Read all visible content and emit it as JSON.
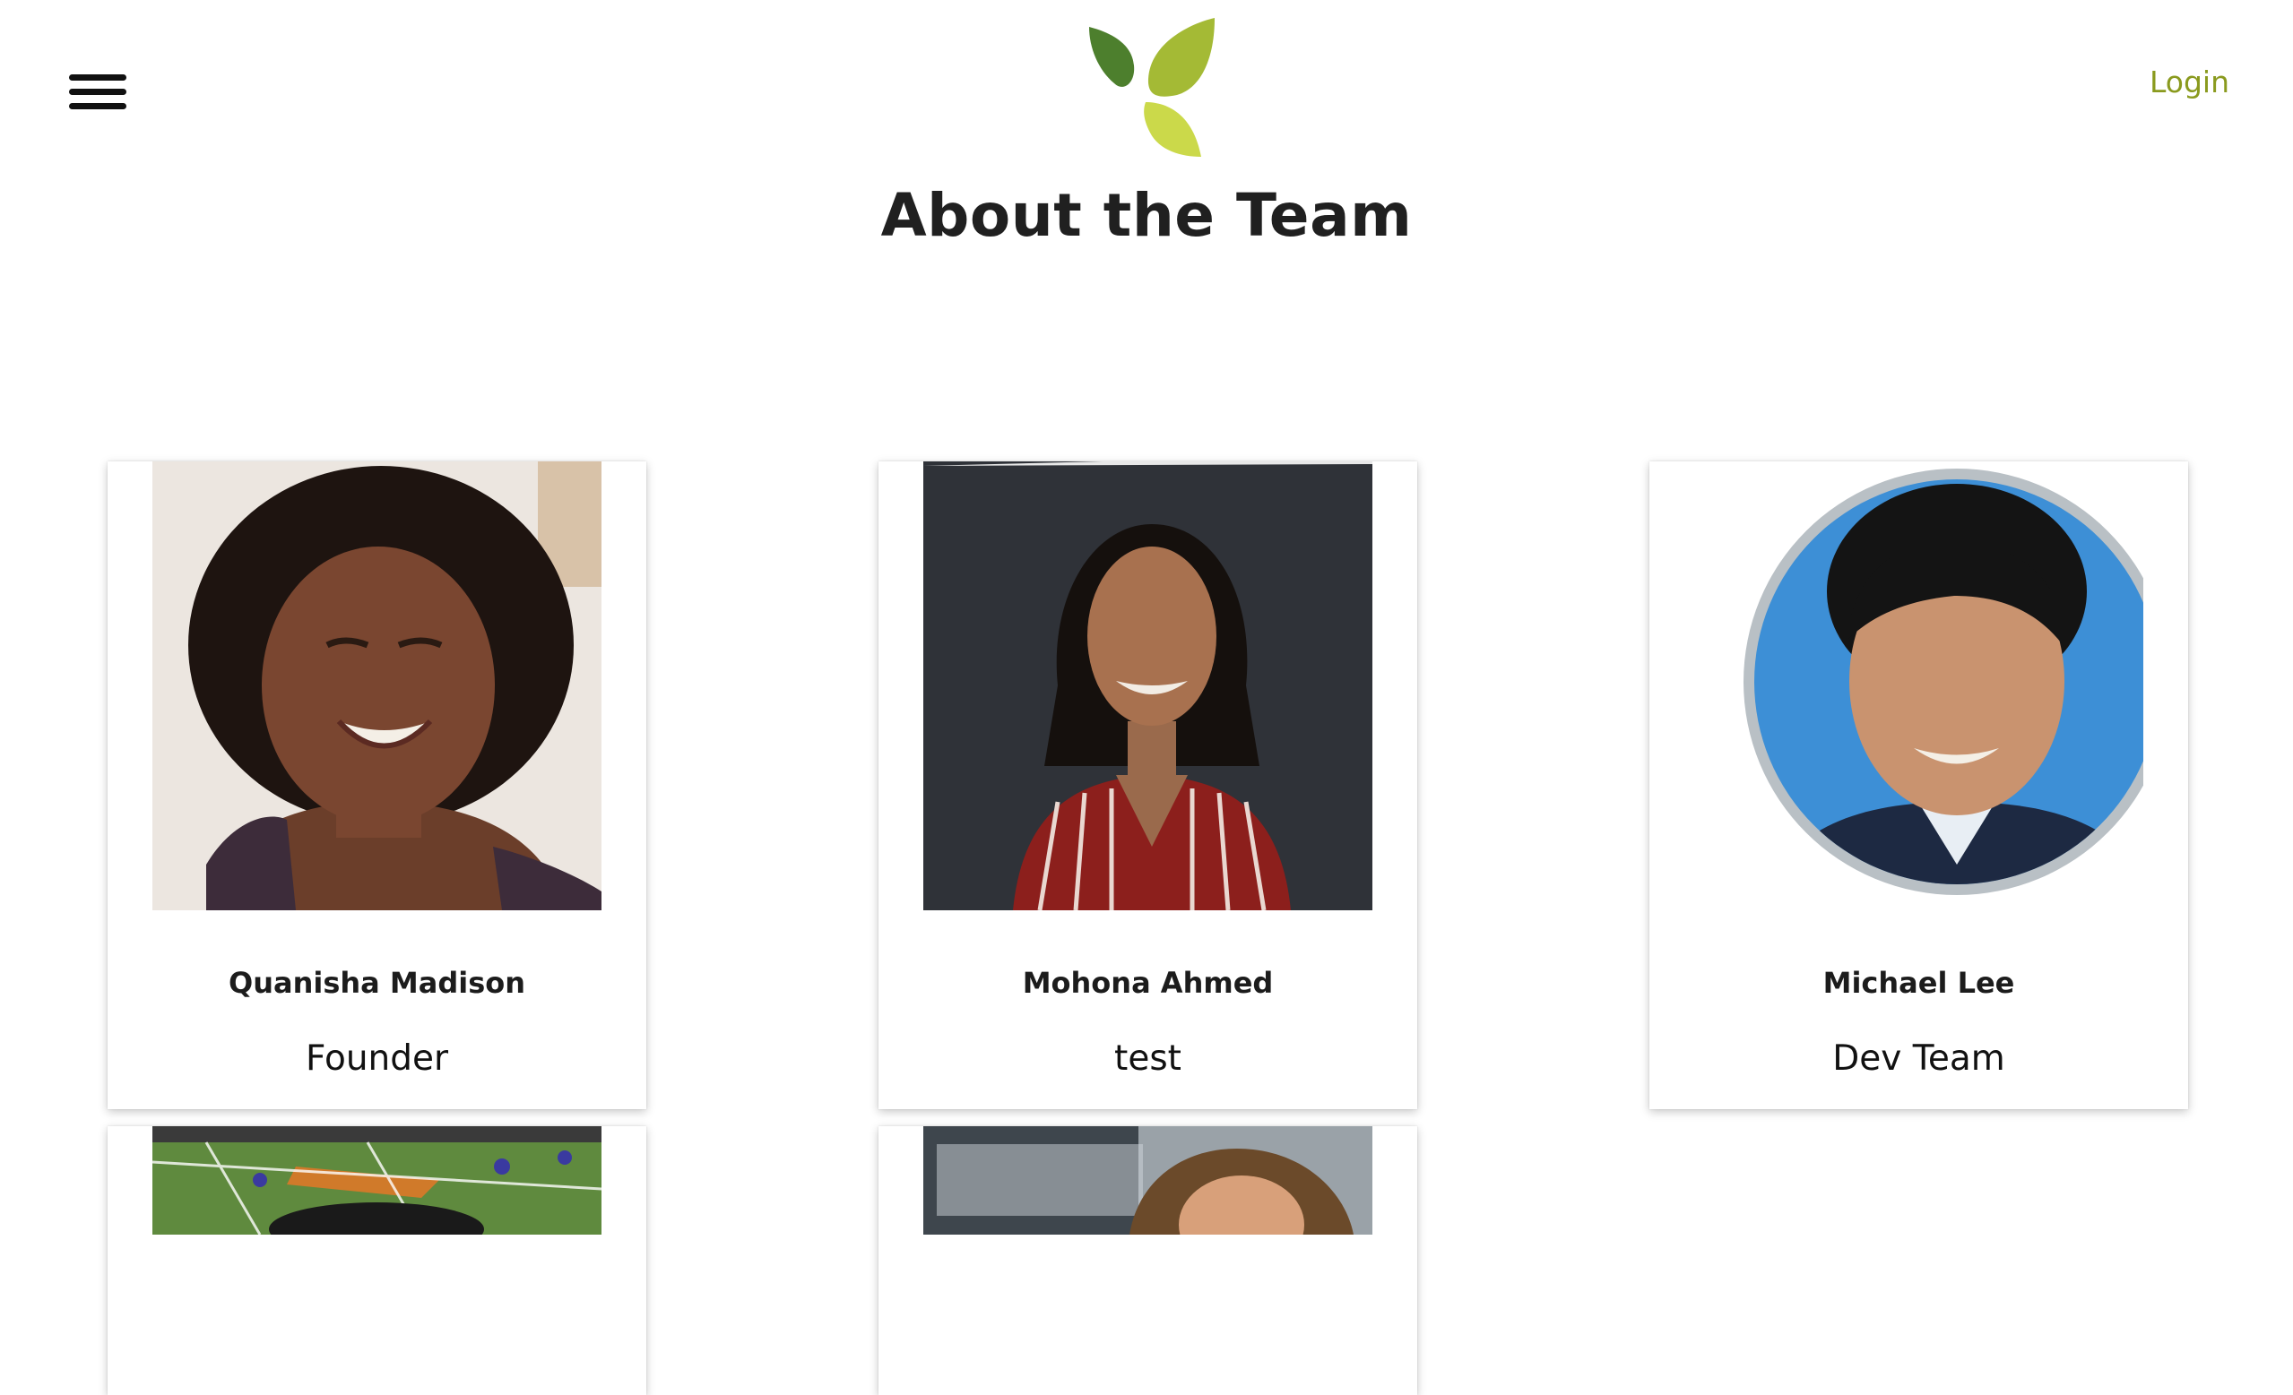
{
  "header": {
    "title": "About the Team",
    "login_label": "Login"
  },
  "colors": {
    "accent": "#8a9a1e",
    "logo_dark_leaf": "#4d7f2d",
    "logo_mid_leaf": "#a4ba35",
    "logo_light_leaf": "#cbd94a"
  },
  "team": [
    {
      "name": "Quanisha Madison",
      "role": "Founder"
    },
    {
      "name": "Mohona Ahmed",
      "role": "test"
    },
    {
      "name": "Michael Lee",
      "role": "Dev Team"
    }
  ],
  "icons": {
    "menu": "hamburger-menu-icon",
    "logo": "three-leaf-logo"
  }
}
